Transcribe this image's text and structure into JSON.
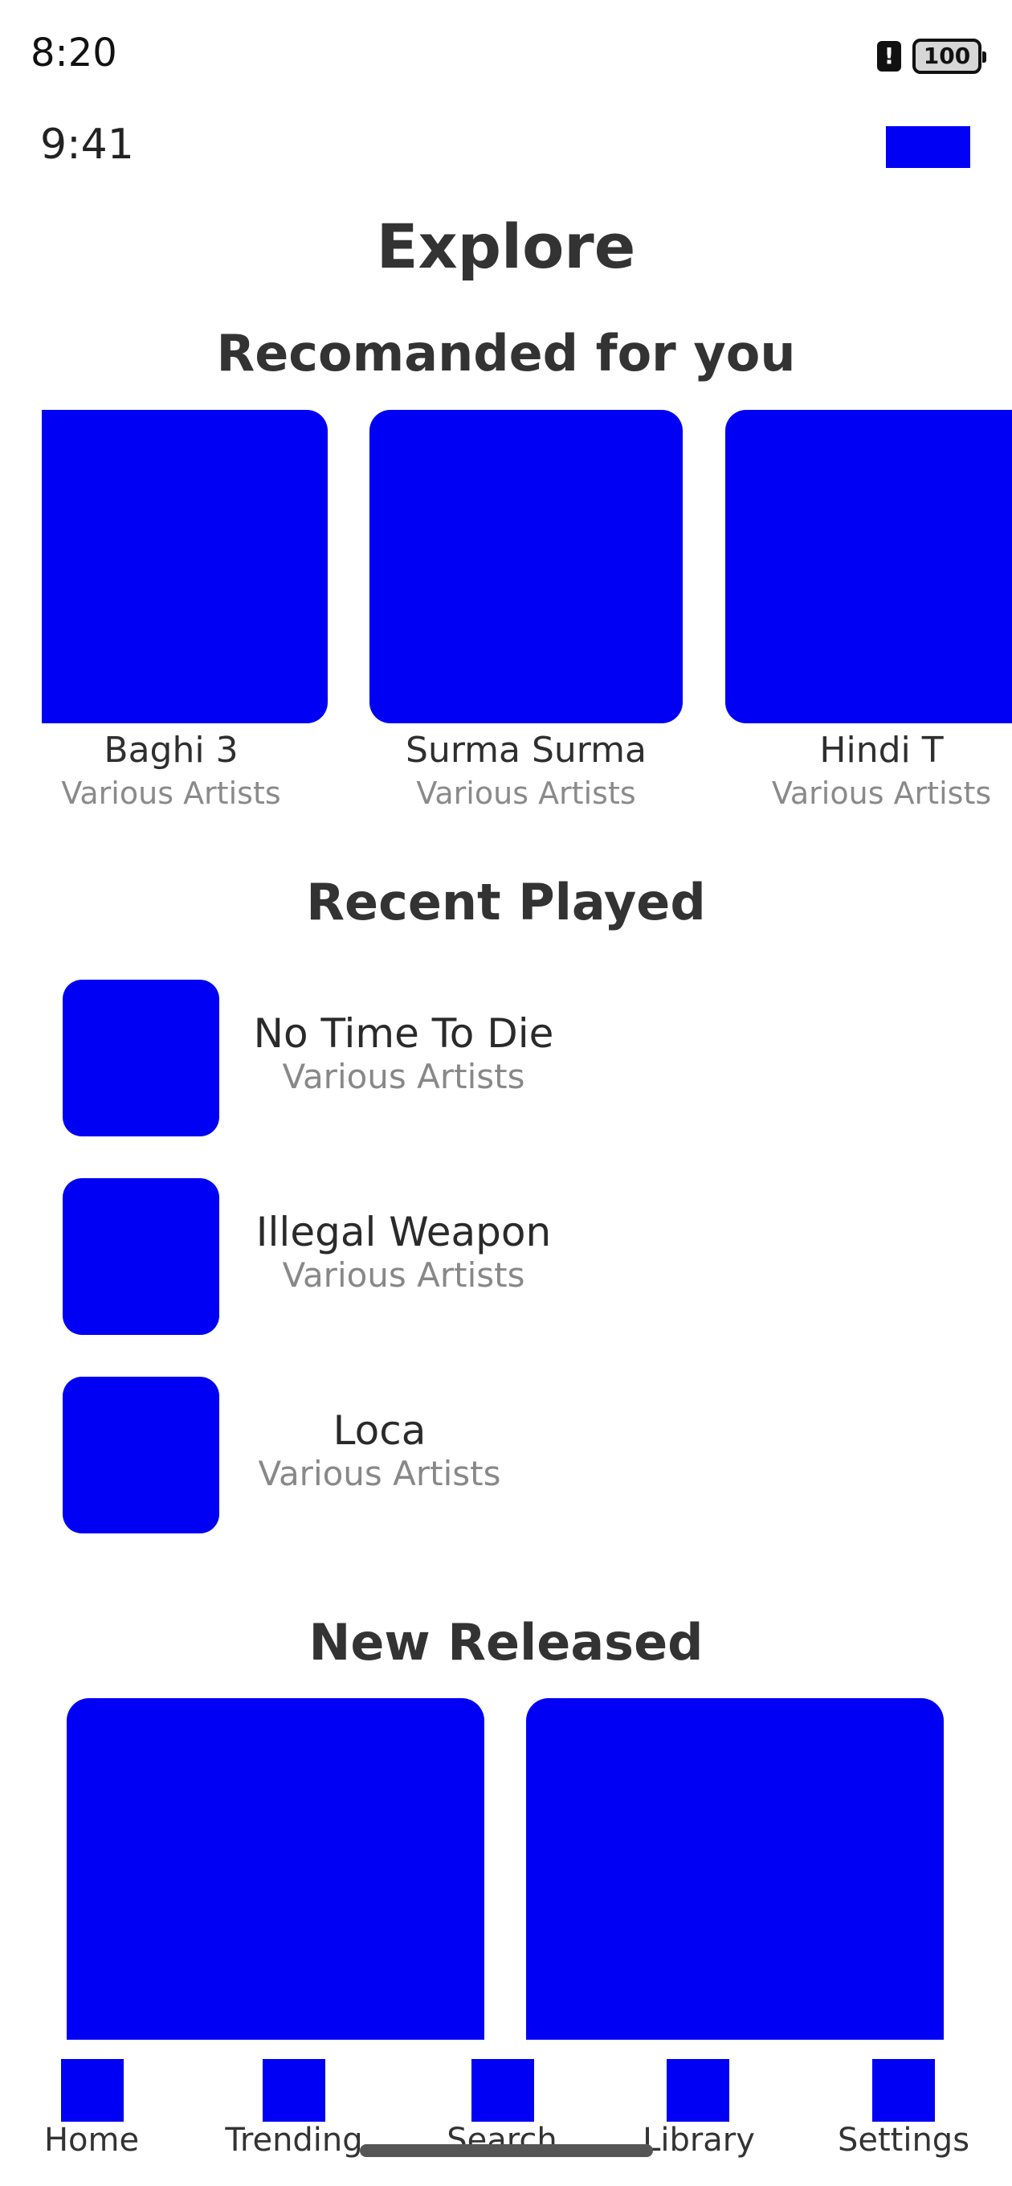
{
  "status_bar": {
    "time": "8:20",
    "battery": "100"
  },
  "header": {
    "time": "9:41"
  },
  "page_title": "Explore",
  "recommended": {
    "title": "Recomanded for you",
    "items": [
      {
        "title": "Baghi 3",
        "subtitle": "Various Artists"
      },
      {
        "title": "Surma Surma",
        "subtitle": "Various Artists"
      },
      {
        "title": "Hindi T",
        "subtitle": "Various Artists"
      }
    ]
  },
  "recent": {
    "title": "Recent Played",
    "items": [
      {
        "title": "No Time To Die",
        "subtitle": "Various Artists"
      },
      {
        "title": "Illegal Weapon",
        "subtitle": "Various Artists"
      },
      {
        "title": "Loca",
        "subtitle": "Various Artists"
      }
    ]
  },
  "new_released": {
    "title": "New Released"
  },
  "nav": [
    {
      "label": "Home"
    },
    {
      "label": "Trending"
    },
    {
      "label": "Search"
    },
    {
      "label": "Library"
    },
    {
      "label": "Settings"
    }
  ],
  "colors": {
    "placeholder": "#0000f5",
    "text": "#2f2f2f",
    "muted": "#888888"
  }
}
